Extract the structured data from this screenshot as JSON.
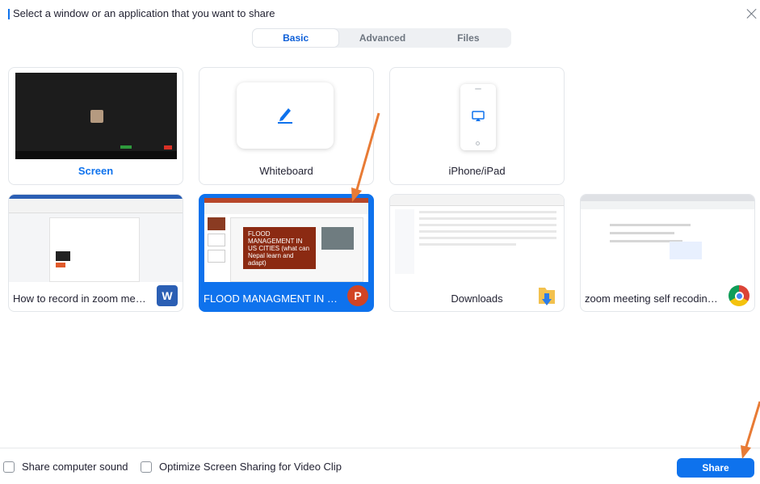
{
  "dialog": {
    "title": "Select a window or an application that you want to share"
  },
  "tabs": [
    {
      "label": "Basic",
      "active": true
    },
    {
      "label": "Advanced",
      "active": false
    },
    {
      "label": "Files",
      "active": false
    }
  ],
  "tiles": {
    "screen": {
      "label": "Screen"
    },
    "whiteboard": {
      "label": "Whiteboard"
    },
    "iphone": {
      "label": "iPhone/iPad"
    },
    "word": {
      "label": "How to record in zoom meeting ...",
      "icon": "word-icon"
    },
    "powerpoint": {
      "label": "FLOOD MANAGMENT IN US CITI...",
      "icon": "powerpoint-icon",
      "slide_text": "FLOOD MANAGEMENT IN US CITIES (what can Nepal learn and adapt)"
    },
    "downloads": {
      "label": "Downloads",
      "icon": "folder-icon"
    },
    "chrome": {
      "label": "zoom meeting self recoding step...",
      "icon": "chrome-icon"
    }
  },
  "footer": {
    "share_sound_label": "Share computer sound",
    "optimize_label": "Optimize Screen Sharing for Video Clip",
    "share_button": "Share"
  },
  "colors": {
    "accent": "#0e72ed",
    "annotation_arrow": "#e87b35"
  }
}
